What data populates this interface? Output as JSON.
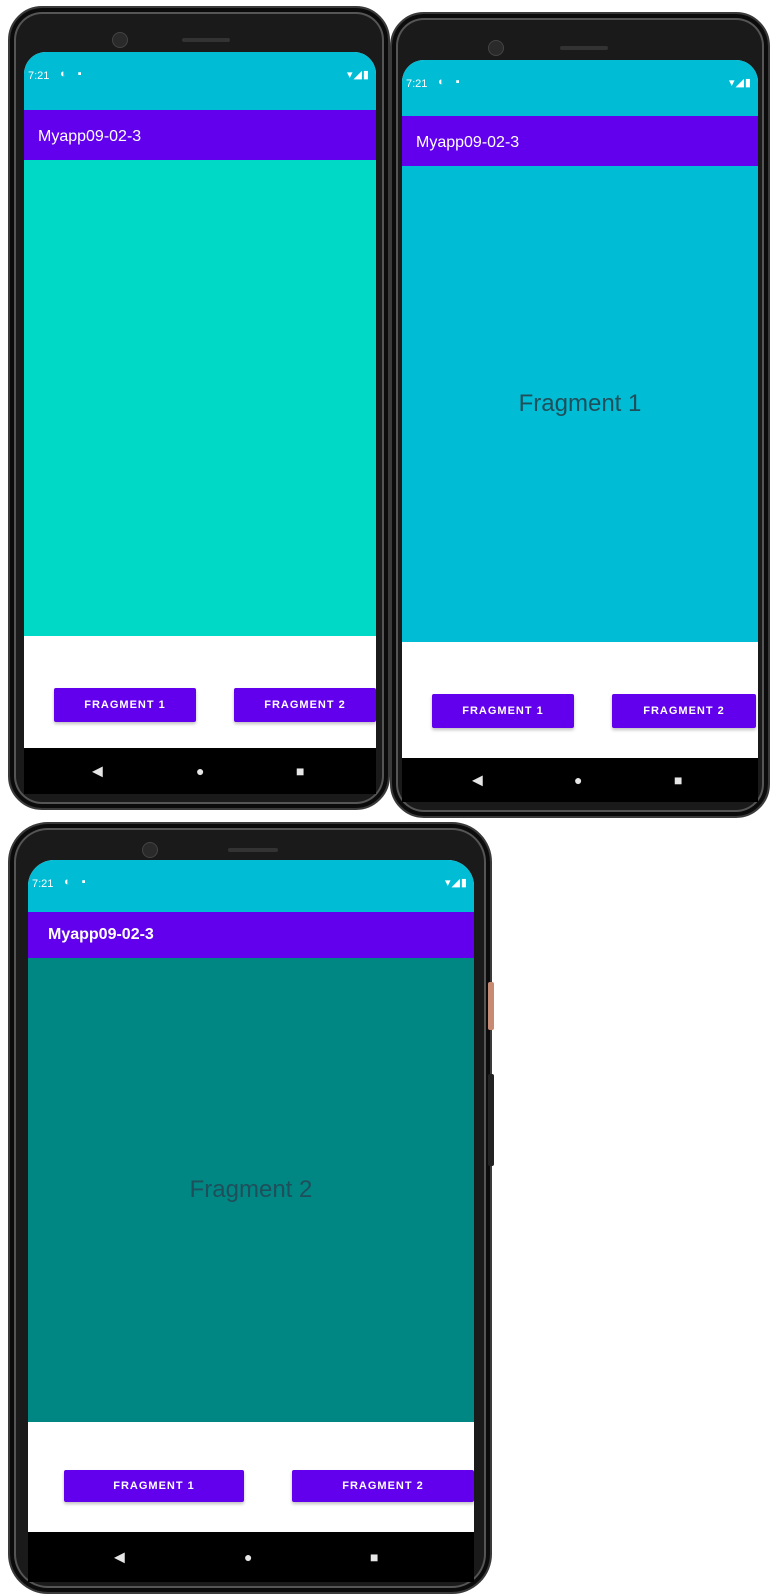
{
  "colors": {
    "status_bar": "#00BCD4",
    "app_bar": "#6200EE",
    "button": "#6200EE",
    "fragment_empty": "#00D9C5",
    "fragment_1": "#00BCD4",
    "fragment_2": "#008784"
  },
  "screens": [
    {
      "status": {
        "time": "7:21",
        "left_icons": "◐ ▪",
        "right_icons": "▾◢▮"
      },
      "app_title": "Myapp09-02-3",
      "fragment_text": "",
      "buttons": {
        "fragment1": "FRAGMENT 1",
        "fragment2": "FRAGMENT 2"
      },
      "nav": {
        "back": "◀",
        "home": "●",
        "recents": "■"
      }
    },
    {
      "status": {
        "time": "7:21",
        "left_icons": "◐ ▪",
        "right_icons": "▾◢▮"
      },
      "app_title": "Myapp09-02-3",
      "fragment_text": "Fragment 1",
      "buttons": {
        "fragment1": "FRAGMENT 1",
        "fragment2": "FRAGMENT 2"
      },
      "nav": {
        "back": "◀",
        "home": "●",
        "recents": "■"
      }
    },
    {
      "status": {
        "time": "7:21",
        "left_icons": "◐ ▪",
        "right_icons": "▾◢▮"
      },
      "app_title": "Myapp09-02-3",
      "fragment_text": "Fragment 2",
      "buttons": {
        "fragment1": "FRAGMENT 1",
        "fragment2": "FRAGMENT 2"
      },
      "nav": {
        "back": "◀",
        "home": "●",
        "recents": "■"
      }
    }
  ]
}
